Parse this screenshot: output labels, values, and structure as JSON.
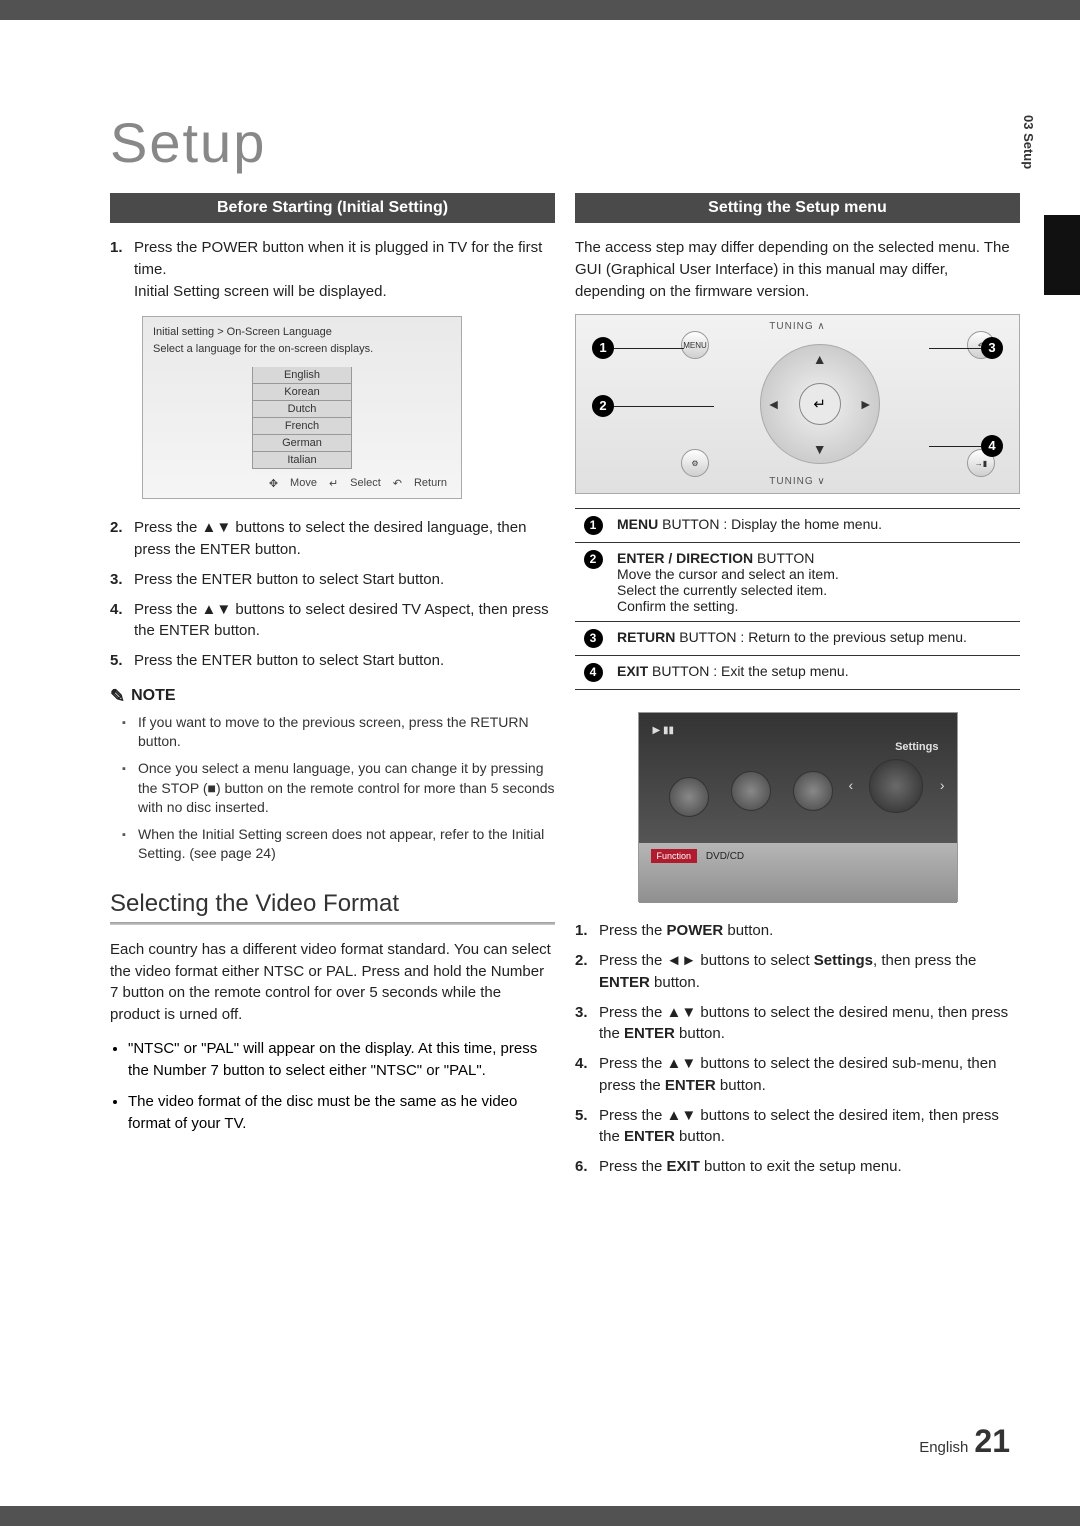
{
  "side": {
    "label": "03  Setup"
  },
  "title": "Setup",
  "left": {
    "bar": "Before Starting (Initial Setting)",
    "step1": "Press the POWER button when it is plugged in TV for the first time.\nInitial Setting screen will be displayed.",
    "screen": {
      "breadcrumb": "Initial setting > On-Screen Language",
      "prompt": "Select a language for the on-screen displays.",
      "langs": [
        "English",
        "Korean",
        "Dutch",
        "French",
        "German",
        "Italian"
      ],
      "footer": {
        "move": "Move",
        "select": "Select",
        "return": "Return"
      }
    },
    "step2": "Press the ▲▼ buttons to select the desired language, then press the ENTER button.",
    "step3": "Press the ENTER button to select Start button.",
    "step4": "Press the ▲▼ buttons to select desired TV Aspect, then press the ENTER button.",
    "step5": "Press the ENTER button to select Start button.",
    "noteHead": "NOTE",
    "notes": [
      "If you want to move to the previous screen, press the RETURN button.",
      "Once you select a menu language, you can change it by pressing the STOP (■) button on the remote control for more than 5 seconds with no disc inserted.",
      "When the Initial Setting screen does not appear, refer to the Initial Setting. (see page 24)"
    ],
    "subhead": "Selecting the Video Format",
    "video_intro": "Each country has a different video format standard. You can select the video format either NTSC or PAL. Press and hold the Number 7 button on the remote control for over 5 seconds while the product is urned off.",
    "video_bullets": [
      "\"NTSC\" or \"PAL\" will appear on the display. At this time, press the Number 7 button to select either \"NTSC\" or \"PAL\".",
      "The video format of the disc must be the same as he video format of your TV."
    ]
  },
  "right": {
    "bar": "Setting the Setup menu",
    "intro": "The access step may differ depending on the selected menu. The GUI (Graphical User Interface) in this manual may differ, depending on the firmware version.",
    "remote": {
      "tuning_top": "TUNING ∧",
      "tuning_bottom": "TUNING ∨",
      "menu": "MENU",
      "return": "RETURN",
      "tools": "TOOLS",
      "exit": "EXIT",
      "enter_sym": "↵"
    },
    "btn_table": [
      {
        "n": "1",
        "html": "MENU BUTTON : Display the home menu."
      },
      {
        "n": "2",
        "html": "ENTER / DIRECTION BUTTON\nMove the cursor and select an item.\nSelect the currently selected item.\nConfirm the setting."
      },
      {
        "n": "3",
        "html": "RETURN BUTTON : Return to the previous setup menu."
      },
      {
        "n": "4",
        "html": "EXIT BUTTON : Exit the setup menu."
      }
    ],
    "settings_shot": {
      "settings": "Settings",
      "function": "Function",
      "mode": "DVD/CD",
      "play_pause": "▶ ▮▮"
    },
    "steps": [
      "Press the POWER button.",
      "Press the ◄► buttons to select Settings, then press the ENTER button.",
      "Press the ▲▼ buttons to select the desired menu, then press the ENTER button.",
      "Press the ▲▼ buttons to select the desired sub-menu, then press the ENTER button.",
      "Press the ▲▼ buttons to select the desired item, then press the ENTER button.",
      "Press the EXIT button to exit the setup menu."
    ]
  },
  "footer": {
    "lang": "English",
    "page": "21"
  }
}
